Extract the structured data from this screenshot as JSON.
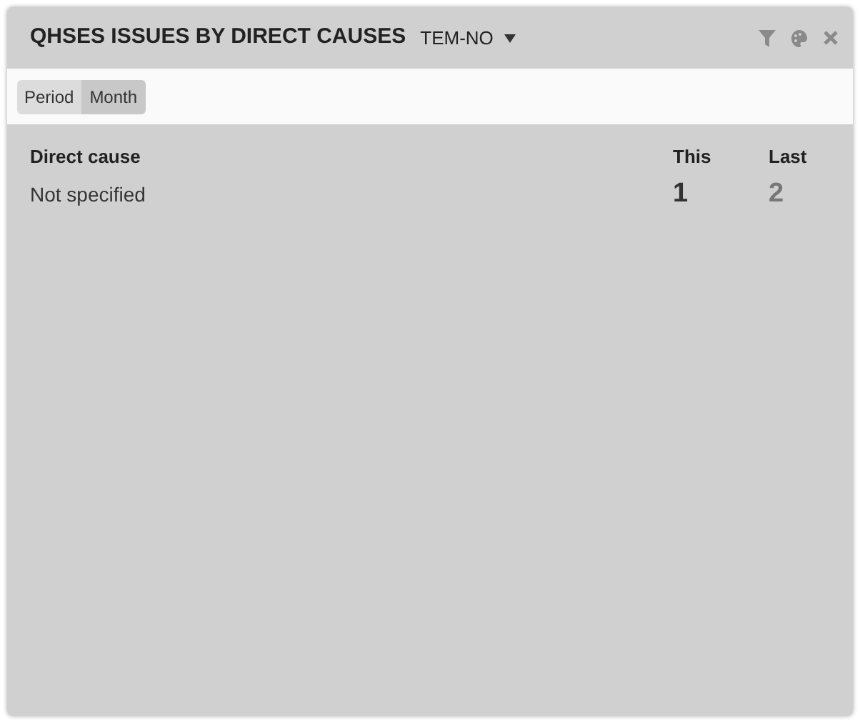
{
  "widget": {
    "title": "QHSES ISSUES BY DIRECT CAUSES",
    "scope": "TEM-NO"
  },
  "period_filter": {
    "label": "Period",
    "value": "Month"
  },
  "table": {
    "columns": [
      "Direct cause",
      "This",
      "Last"
    ],
    "rows": [
      {
        "cause": "Not specified",
        "this": "1",
        "last": "2"
      }
    ]
  }
}
